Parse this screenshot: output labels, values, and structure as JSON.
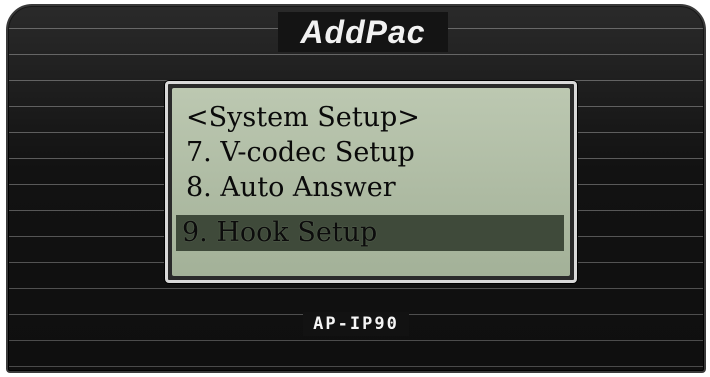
{
  "device": {
    "brand": "AddPac",
    "model": "AP-IP90"
  },
  "lcd": {
    "title": "<System Setup>",
    "items": [
      {
        "label": "7. V-codec Setup"
      },
      {
        "label": "8. Auto Answer"
      },
      {
        "label": "9. Hook Setup",
        "selected": true
      }
    ]
  },
  "colors": {
    "bezel": "#121212",
    "lcd_background": "#b3c0a8",
    "lcd_text": "#0a0a0a",
    "selection_bar": "#3f4a3a",
    "label_text": "#f2f2f2"
  }
}
